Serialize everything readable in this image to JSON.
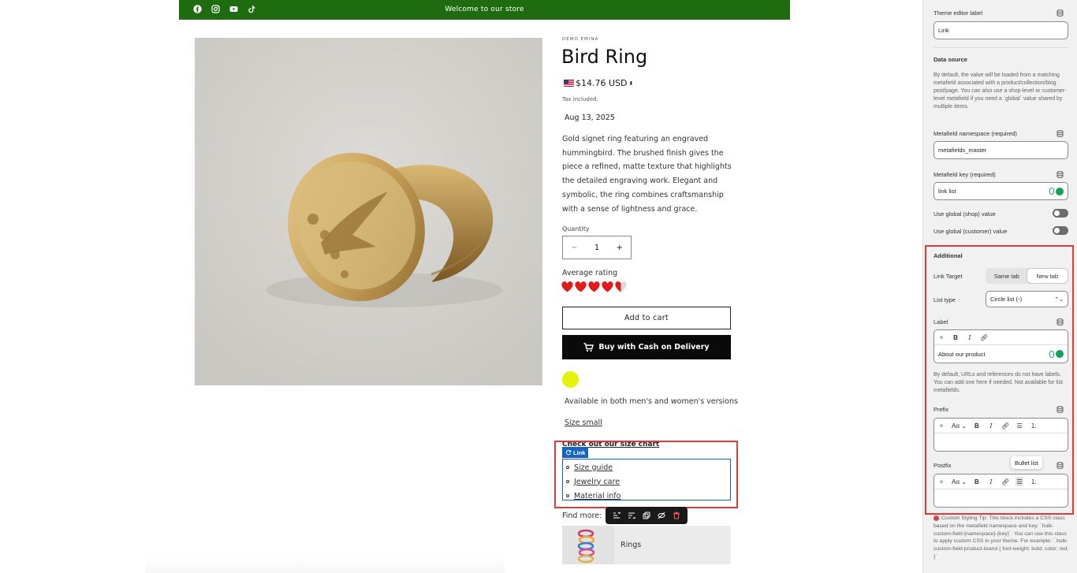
{
  "store": {
    "announcement": "Welcome to our store",
    "social_icons": [
      "facebook-icon",
      "instagram-icon",
      "youtube-icon",
      "tiktok-icon"
    ],
    "product": {
      "vendor": "DEMO EMINA",
      "title": "Bird Ring",
      "price": "$14.76 USD",
      "tax_note": "Tax included.",
      "date": "Aug 13, 2025",
      "description": "Gold signet ring featuring an engraved hummingbird. The brushed finish gives the piece a refined, matte texture that highlights the detailed engraving work. Elegant and symbolic, the ring combines craftsmanship with a sense of lightness and grace.",
      "quantity_label": "Quantity",
      "quantity": "1",
      "qty_minus": "−",
      "qty_plus": "+",
      "rating_label": "Average rating",
      "rating": 4.5,
      "rating_max": 5,
      "add_to_cart": "Add to cart",
      "buy_cod": "Buy with Cash on Delivery",
      "swatch_color": "#e5f20a",
      "availability": "Available in both men's and women's versions",
      "size_small": "Size small",
      "size_chart_heading": "Check out our size chart",
      "link_tag": "Link",
      "links": [
        "Size guide",
        "Jewelry care",
        "Material info"
      ],
      "find_more": "Find more:",
      "collection_card": "Rings"
    }
  },
  "sidebar": {
    "theme_editor_label": "Theme editor label",
    "theme_editor_value": "Link",
    "data_source_heading": "Data source",
    "data_source_desc": "By default, the value will be loaded from a matching metafield associated with a product/collection/blog post/page. You can also use a shop-level or customer-level metafield if you need a `global` value shared by multiple items.",
    "namespace_label": "Metafield namespace (required)",
    "namespace_value": "metafields_master",
    "key_label": "Metafield key (required)",
    "key_value": "link list",
    "global_shop_label": "Use global (shop) value",
    "global_customer_label": "Use global (customer) value",
    "additional_heading": "Additional",
    "link_target_label": "Link Target",
    "link_target_options": [
      "Same tab",
      "New tab"
    ],
    "list_type_label": "List type",
    "list_type_value": "Circle list (◦)",
    "label_label": "Label",
    "label_value": "About our product",
    "label_help": "By default, URLs and references do not have labels. You can add one here if needed. Not available for list metafields.",
    "prefix_label": "Prefix",
    "postfix_label": "Postfix",
    "font_btn": "Aα",
    "tooltip": "Bullet list",
    "tip_text": "Custom Styling Tip: This block includes a CSS class based on the metafield namespace and key: `hulk-custom-field-{namespace}-{key}`. You can use this class to apply custom CSS in your theme. For example: `.hulk-custom-field-product-brand { font-weight: bold; color: red; }`",
    "colors": {
      "accent_red": "#e53935",
      "editor_blue": "#1565c0",
      "toggle_gray": "#6b6b6b"
    }
  }
}
